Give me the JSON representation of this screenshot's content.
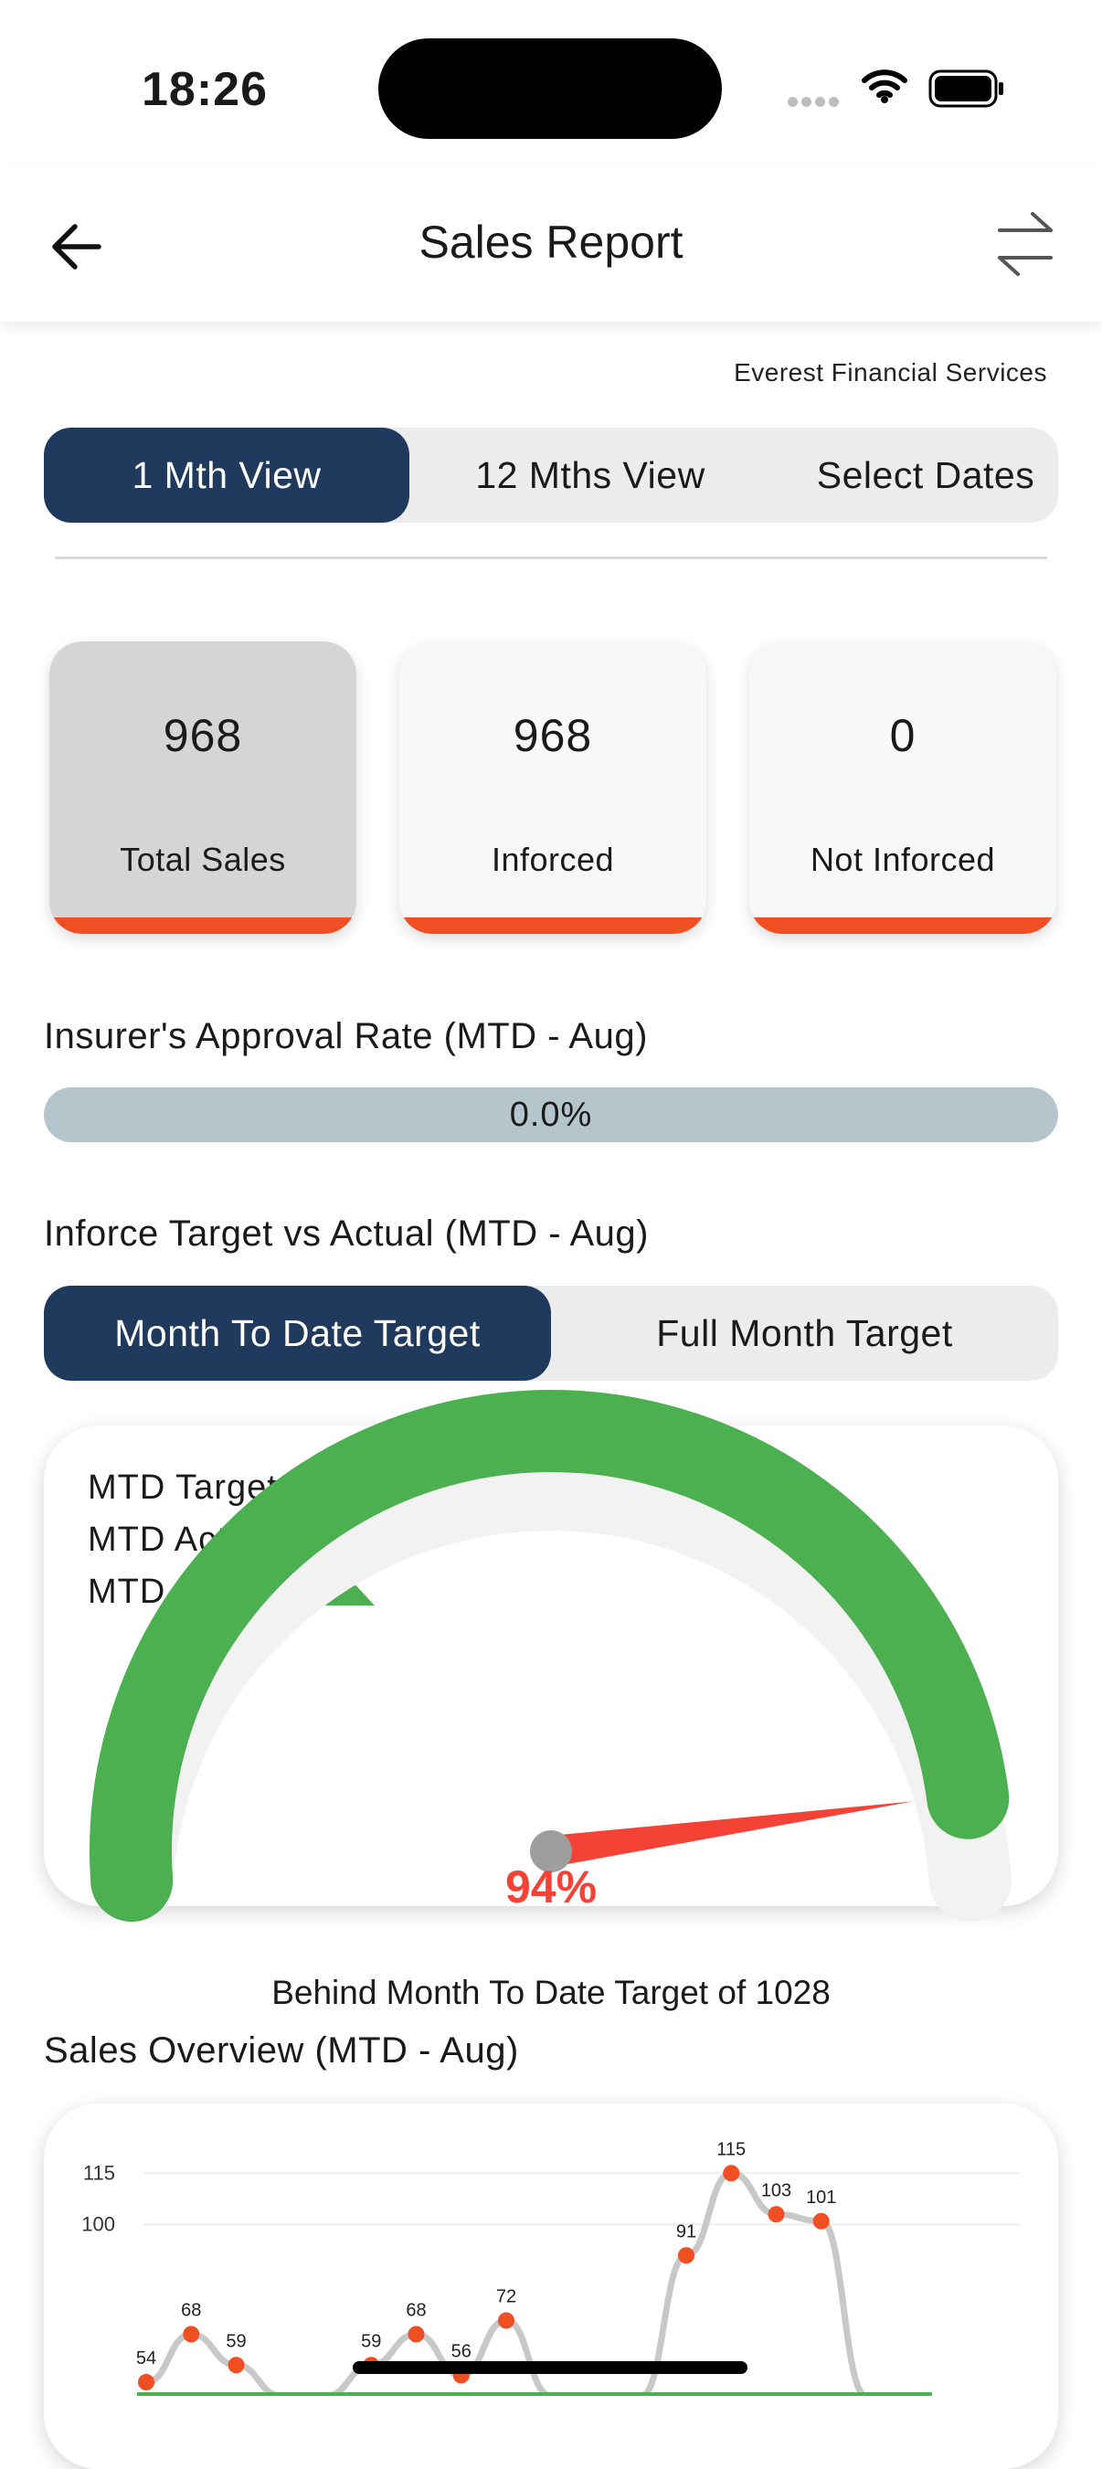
{
  "status_bar": {
    "time": "18:26"
  },
  "header": {
    "title": "Sales Report",
    "back_icon": "arrow-left-icon",
    "swap_icon": "swap-arrows-icon"
  },
  "company": "Everest Financial Services",
  "view_tabs": {
    "items": [
      "1 Mth View",
      "12 Mths View",
      "Select Dates"
    ],
    "active": 0
  },
  "stats": [
    {
      "value": "968",
      "label": "Total Sales"
    },
    {
      "value": "968",
      "label": "Inforced"
    },
    {
      "value": "0",
      "label": "Not Inforced"
    }
  ],
  "approval": {
    "title": "Insurer's Approval Rate (MTD - Aug)",
    "value_text": "0.0%",
    "value": 0.0
  },
  "inforce": {
    "title": "Inforce Target vs Actual (MTD - Aug)",
    "tabs": [
      "Month To Date Target",
      "Full Month Target"
    ],
    "active": 0
  },
  "gauge": {
    "target_line": "MTD Target = 1028",
    "actual_line": "MTD Actual = 968",
    "diff_line": "MTD Diff = 60",
    "percent_text": "94%",
    "percent": 94,
    "colors": {
      "arc": "#4caf50",
      "track": "#f2f2f2",
      "needle": "#f44336",
      "hub": "#9e9e9e",
      "percent": "#f44336"
    }
  },
  "behind_text": "Behind Month To Date Target of 1028",
  "overview": {
    "title": "Sales Overview (MTD - Aug)"
  },
  "chart_data": {
    "type": "line",
    "yticks": [
      100,
      115
    ],
    "ylim": [
      50,
      122
    ],
    "target": 50,
    "series": [
      {
        "values": [
          54,
          68,
          59,
          50,
          50,
          59,
          68,
          56,
          72,
          50,
          50,
          50,
          91,
          115,
          103,
          101,
          50
        ]
      }
    ],
    "point_labels": [
      {
        "i": 0,
        "text": "54"
      },
      {
        "i": 1,
        "text": "68"
      },
      {
        "i": 2,
        "text": "59"
      },
      {
        "i": 5,
        "text": "59"
      },
      {
        "i": 6,
        "text": "68"
      },
      {
        "i": 7,
        "text": "56"
      },
      {
        "i": 8,
        "text": "72"
      },
      {
        "i": 12,
        "text": "91"
      },
      {
        "i": 13,
        "text": "115"
      },
      {
        "i": 14,
        "text": "103"
      },
      {
        "i": 15,
        "text": "101"
      }
    ],
    "colors": {
      "line": "#c8c8c8",
      "point": "#f04e23",
      "target": "#4caf50",
      "grid": "#eeeeee"
    }
  }
}
